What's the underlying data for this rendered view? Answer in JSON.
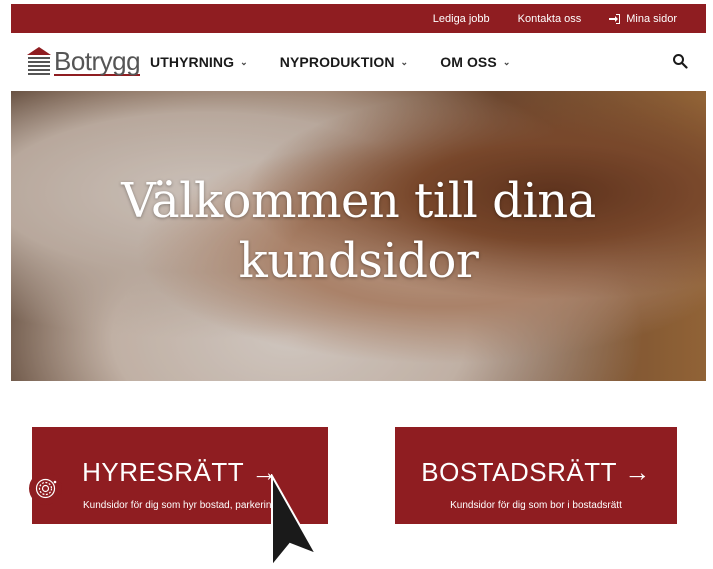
{
  "topbar": {
    "links": [
      "Lediga jobb",
      "Kontakta oss"
    ],
    "login_label": "Mina sidor"
  },
  "logo": {
    "text": "Botrygg"
  },
  "nav": {
    "items": [
      {
        "label": "UTHYRNING"
      },
      {
        "label": "NYPRODUKTION"
      },
      {
        "label": "OM OSS"
      }
    ]
  },
  "hero": {
    "title_line1": "Välkommen till dina",
    "title_line2": "kundsidor"
  },
  "cards": [
    {
      "title": "HYRESRÄTT →",
      "subtitle": "Kundsidor för dig som hyr bostad, parkering"
    },
    {
      "title": "BOSTADSRÄTT →",
      "subtitle": "Kundsidor för dig som bor i bostadsrätt"
    }
  ],
  "colors": {
    "brand": "#8f1d21",
    "text": "#1a1a1a"
  },
  "icons": [
    "login-icon",
    "chevron-down-icon",
    "search-icon",
    "accessibility-icon",
    "cursor-arrow-icon"
  ]
}
